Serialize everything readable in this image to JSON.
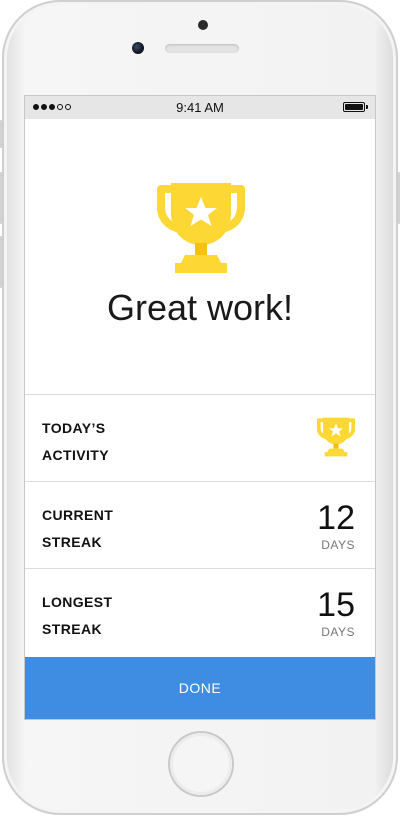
{
  "status_bar": {
    "time": "9:41 AM",
    "signal_filled": 3,
    "signal_total": 5,
    "battery_level": 1.0
  },
  "hero": {
    "icon": "trophy-icon",
    "headline": "Great work!"
  },
  "rows": [
    {
      "label_line1": "TODAY’S",
      "label_line2": "ACTIVITY",
      "icon": "trophy-icon"
    },
    {
      "label_line1": "CURRENT",
      "label_line2": "STREAK",
      "value": "12",
      "unit": "DAYS"
    },
    {
      "label_line1": "LONGEST",
      "label_line2": "STREAK",
      "value": "15",
      "unit": "DAYS"
    }
  ],
  "done_label": "DONE",
  "colors": {
    "accent": "#3f8de3",
    "trophy": "#fdd835",
    "trophy_shade": "#f9c012",
    "status_bar_bg": "#e6e6e6"
  }
}
